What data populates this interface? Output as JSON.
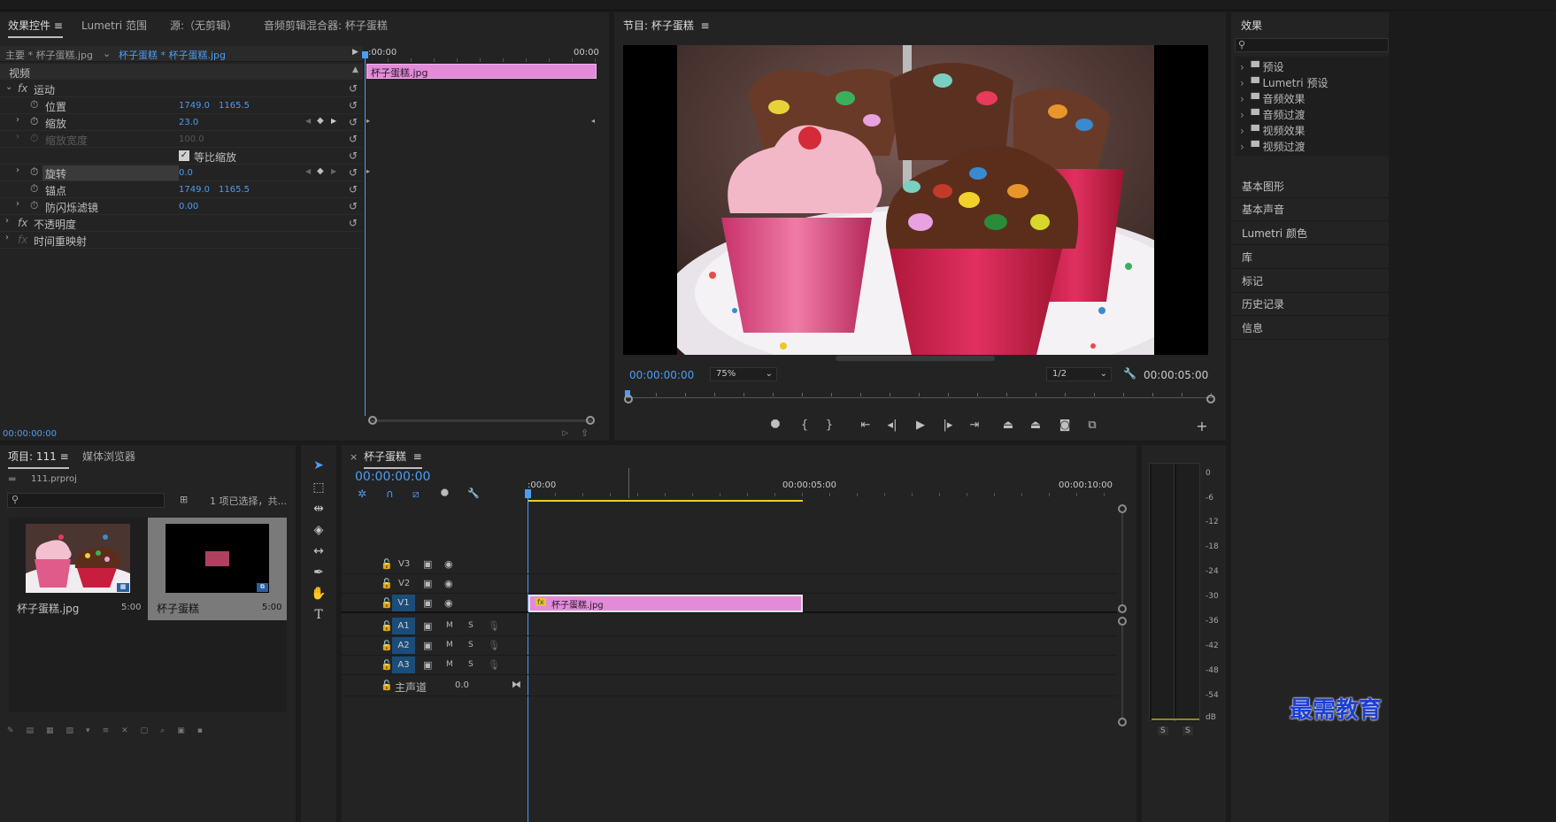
{
  "effect_controls": {
    "tabs": [
      "效果控件",
      "Lumetri 范围",
      "源:（无剪辑）",
      "音频剪辑混合器: 杯子蛋糕"
    ],
    "menu_glyph": "≡",
    "source_label": "主要 * 杯子蛋糕.jpg",
    "clip_label": "杯子蛋糕 * 杯子蛋糕.jpg",
    "ruler_start": ":00:00",
    "ruler_end": "00:00",
    "clip_block": "杯子蛋糕.jpg",
    "section": "视频",
    "motion": "运动",
    "fx": "fx",
    "props": {
      "position": {
        "label": "位置",
        "v1": "1749.0",
        "v2": "1165.5"
      },
      "scale": {
        "label": "缩放",
        "v1": "23.0"
      },
      "scale_width": {
        "label": "缩放宽度",
        "v1": "100.0"
      },
      "uniform": "等比缩放",
      "rotation": {
        "label": "旋转",
        "v1": "0.0"
      },
      "anchor": {
        "label": "锚点",
        "v1": "1749.0",
        "v2": "1165.5"
      },
      "flicker": {
        "label": "防闪烁滤镜",
        "v1": "0.00"
      }
    },
    "opacity": "不透明度",
    "time_remap": "时间重映射",
    "timecode": "00:00:00:00"
  },
  "program": {
    "title": "节目: 杯子蛋糕",
    "timecode": "00:00:00:00",
    "zoom": "75%",
    "quality": "1/2",
    "duration": "00:00:05:00"
  },
  "project": {
    "tabs": [
      "项目: 111",
      "媒体浏览器"
    ],
    "file": "111.prproj",
    "selection": "1 项已选择，共...",
    "items": [
      {
        "name": "杯子蛋糕.jpg",
        "dur": "5:00"
      },
      {
        "name": "杯子蛋糕",
        "dur": "5:00"
      }
    ]
  },
  "timeline": {
    "title": "杯子蛋糕",
    "close": "×",
    "timecode": "00:00:00:00",
    "ruler": [
      ":00:00",
      "00:00:05:00",
      "00:00:10:00"
    ],
    "tracks_video": [
      "V3",
      "V2",
      "V1"
    ],
    "tracks_audio": [
      "A1",
      "A2",
      "A3"
    ],
    "master": "主声道",
    "master_val": "0.0",
    "clip": "杯子蛋糕.jpg",
    "m": "M",
    "s": "S"
  },
  "effects_panel": {
    "title": "效果",
    "items": [
      "预设",
      "Lumetri 预设",
      "音频效果",
      "音频过渡",
      "视频效果",
      "视频过渡"
    ],
    "panels": [
      "基本图形",
      "基本声音",
      "Lumetri 颜色",
      "库",
      "标记",
      "历史记录",
      "信息"
    ]
  },
  "meter": {
    "labels": [
      "0",
      "-6",
      "-12",
      "-18",
      "-24",
      "-30",
      "-36",
      "-42",
      "-48",
      "-54",
      "dB"
    ],
    "solo": [
      "S",
      "S"
    ]
  },
  "watermark": "最需教育",
  "colors": {
    "accent": "#4e9cf2",
    "clip": "#e38ad9",
    "track_btn": "#1b4d7a"
  }
}
